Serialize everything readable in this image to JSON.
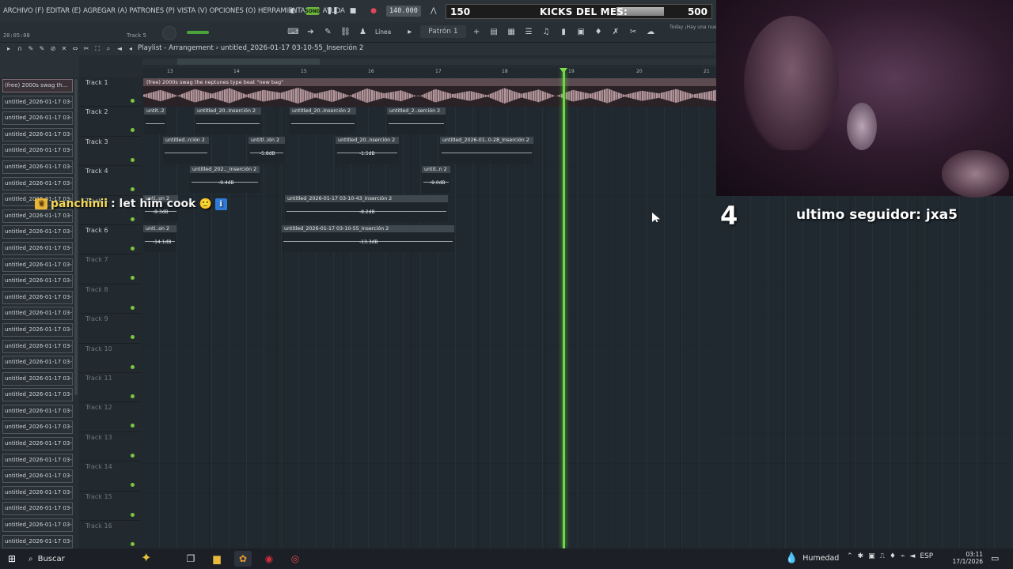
{
  "menu": {
    "items": [
      "ARCHIVO (F)",
      "EDITAR (E)",
      "AGREGAR (A)",
      "PATRONES (P)",
      "VISTA (V)",
      "OPCIONES (O)",
      "HERRAMIENTAS (T)",
      "AYUDA"
    ]
  },
  "transport": {
    "song_label": "SONG",
    "tempo": "140.000"
  },
  "goal": {
    "current": "150",
    "title": "KICKS DEL MES:",
    "target": "500",
    "progress_fraction": 0.3
  },
  "toolbar2": {
    "time": "20:05:08",
    "track_hint": "Track 5",
    "snap_label": "Línea",
    "pattern": "Patrón 1",
    "news": "Today  ¡Hay una nueva versión de FL Studio"
  },
  "playlist": {
    "title": "Playlist - Arrangement",
    "breadcrumb": "untitled_2026-01-17 03-10-55_Inserción 2",
    "bars": [
      "13",
      "14",
      "15",
      "16",
      "17",
      "18",
      "19",
      "20",
      "21"
    ],
    "playhead_bar_label": "19"
  },
  "browser": {
    "items": [
      "(free) 2000s swag th...",
      "untitled_2026-01-17 03-...",
      "untitled_2026-01-17 03-...",
      "untitled_2026-01-17 03-...",
      "untitled_2026-01-17 03-...",
      "untitled_2026-01-17 03-...",
      "untitled_2026-01-17 03-...",
      "untitled_2026-01-17 03-...",
      "untitled_2026-01-17 03-...",
      "untitled_2026-01-17 03-...",
      "untitled_2026-01-17 03-...",
      "untitled_2026-01-17 03-...",
      "untitled_2026-01-17 03-...",
      "untitled_2026-01-17 03-...",
      "untitled_2026-01-17 03-...",
      "untitled_2026-01-17 03-...",
      "untitled_2026-01-17 03-...",
      "untitled_2026-01-17 03-...",
      "untitled_2026-01-17 03-...",
      "untitled_2026-01-17 03-...",
      "untitled_2026-01-17 03-...",
      "untitled_2026-01-17 03-...",
      "untitled_2026-01-17 03-...",
      "untitled_2026-01-17 03-...",
      "untitled_2026-01-17 03-...",
      "untitled_2026-01-17 03-...",
      "untitled_2026-01-17 03-...",
      "untitled_2026-01-17 03-...",
      "untitled_2026-01-17 03-..."
    ]
  },
  "tracks": [
    {
      "name": "Track 1",
      "dim": false
    },
    {
      "name": "Track 2",
      "dim": false
    },
    {
      "name": "Track 3",
      "dim": false
    },
    {
      "name": "Track 4",
      "dim": false
    },
    {
      "name": "Track 5",
      "dim": false
    },
    {
      "name": "Track 6",
      "dim": false
    },
    {
      "name": "Track 7",
      "dim": true
    },
    {
      "name": "Track 8",
      "dim": true
    },
    {
      "name": "Track 9",
      "dim": true
    },
    {
      "name": "Track 10",
      "dim": true
    },
    {
      "name": "Track 11",
      "dim": true
    },
    {
      "name": "Track 12",
      "dim": true
    },
    {
      "name": "Track 13",
      "dim": true
    },
    {
      "name": "Track 14",
      "dim": true
    },
    {
      "name": "Track 15",
      "dim": true
    },
    {
      "name": "Track 16",
      "dim": true
    }
  ],
  "main_clip": {
    "label": "(free) 2000s swag  the neptunes type beat  \"new bag\""
  },
  "clips": [
    {
      "label": "untit..2",
      "db": ""
    },
    {
      "label": "untitled_20..Inserción 2",
      "db": ""
    },
    {
      "label": "untitled_20..Inserción 2",
      "db": ""
    },
    {
      "label": "untitled_2..serción 2",
      "db": ""
    },
    {
      "label": "untitled..rción 2",
      "db": ""
    },
    {
      "label": "untitl..ión 2",
      "db": "-5.8dB"
    },
    {
      "label": "untitled_20..nserción 2",
      "db": "-1.5dB"
    },
    {
      "label": "untitled_2026-01..0-28_Inserción 2",
      "db": ""
    },
    {
      "label": "untitled_202.._Inserción 2",
      "db": "-9.4dB"
    },
    {
      "label": "untit..n 2",
      "db": "-9.0dB"
    },
    {
      "label": "unti..on 2",
      "db": "-9.3dB"
    },
    {
      "label": "untitled_2026-01-17 03-10-43_Inserción 2",
      "db": "-8.2dB"
    },
    {
      "label": "unti..on 2",
      "db": "-14.1dB"
    },
    {
      "label": "untitled_2026-01-17 03-10-55_Inserción 2",
      "db": "-13.3dB"
    }
  ],
  "overlay": {
    "chat_user": "panchinii",
    "chat_message": ": let him cook",
    "chat_emoji": "🙂",
    "chat_info": "ℹ",
    "follower_count": "4",
    "last_follower": "ultimo seguidor: jxa5"
  },
  "taskbar": {
    "search_label": "Buscar",
    "weather": "Humedad",
    "language": "ESP",
    "time": "03:11",
    "date": "17/1/2026"
  },
  "colors": {
    "playhead": "#6fd64a",
    "led": "#7cc640",
    "song_button": "#6db33f",
    "record": "#e0455a"
  }
}
